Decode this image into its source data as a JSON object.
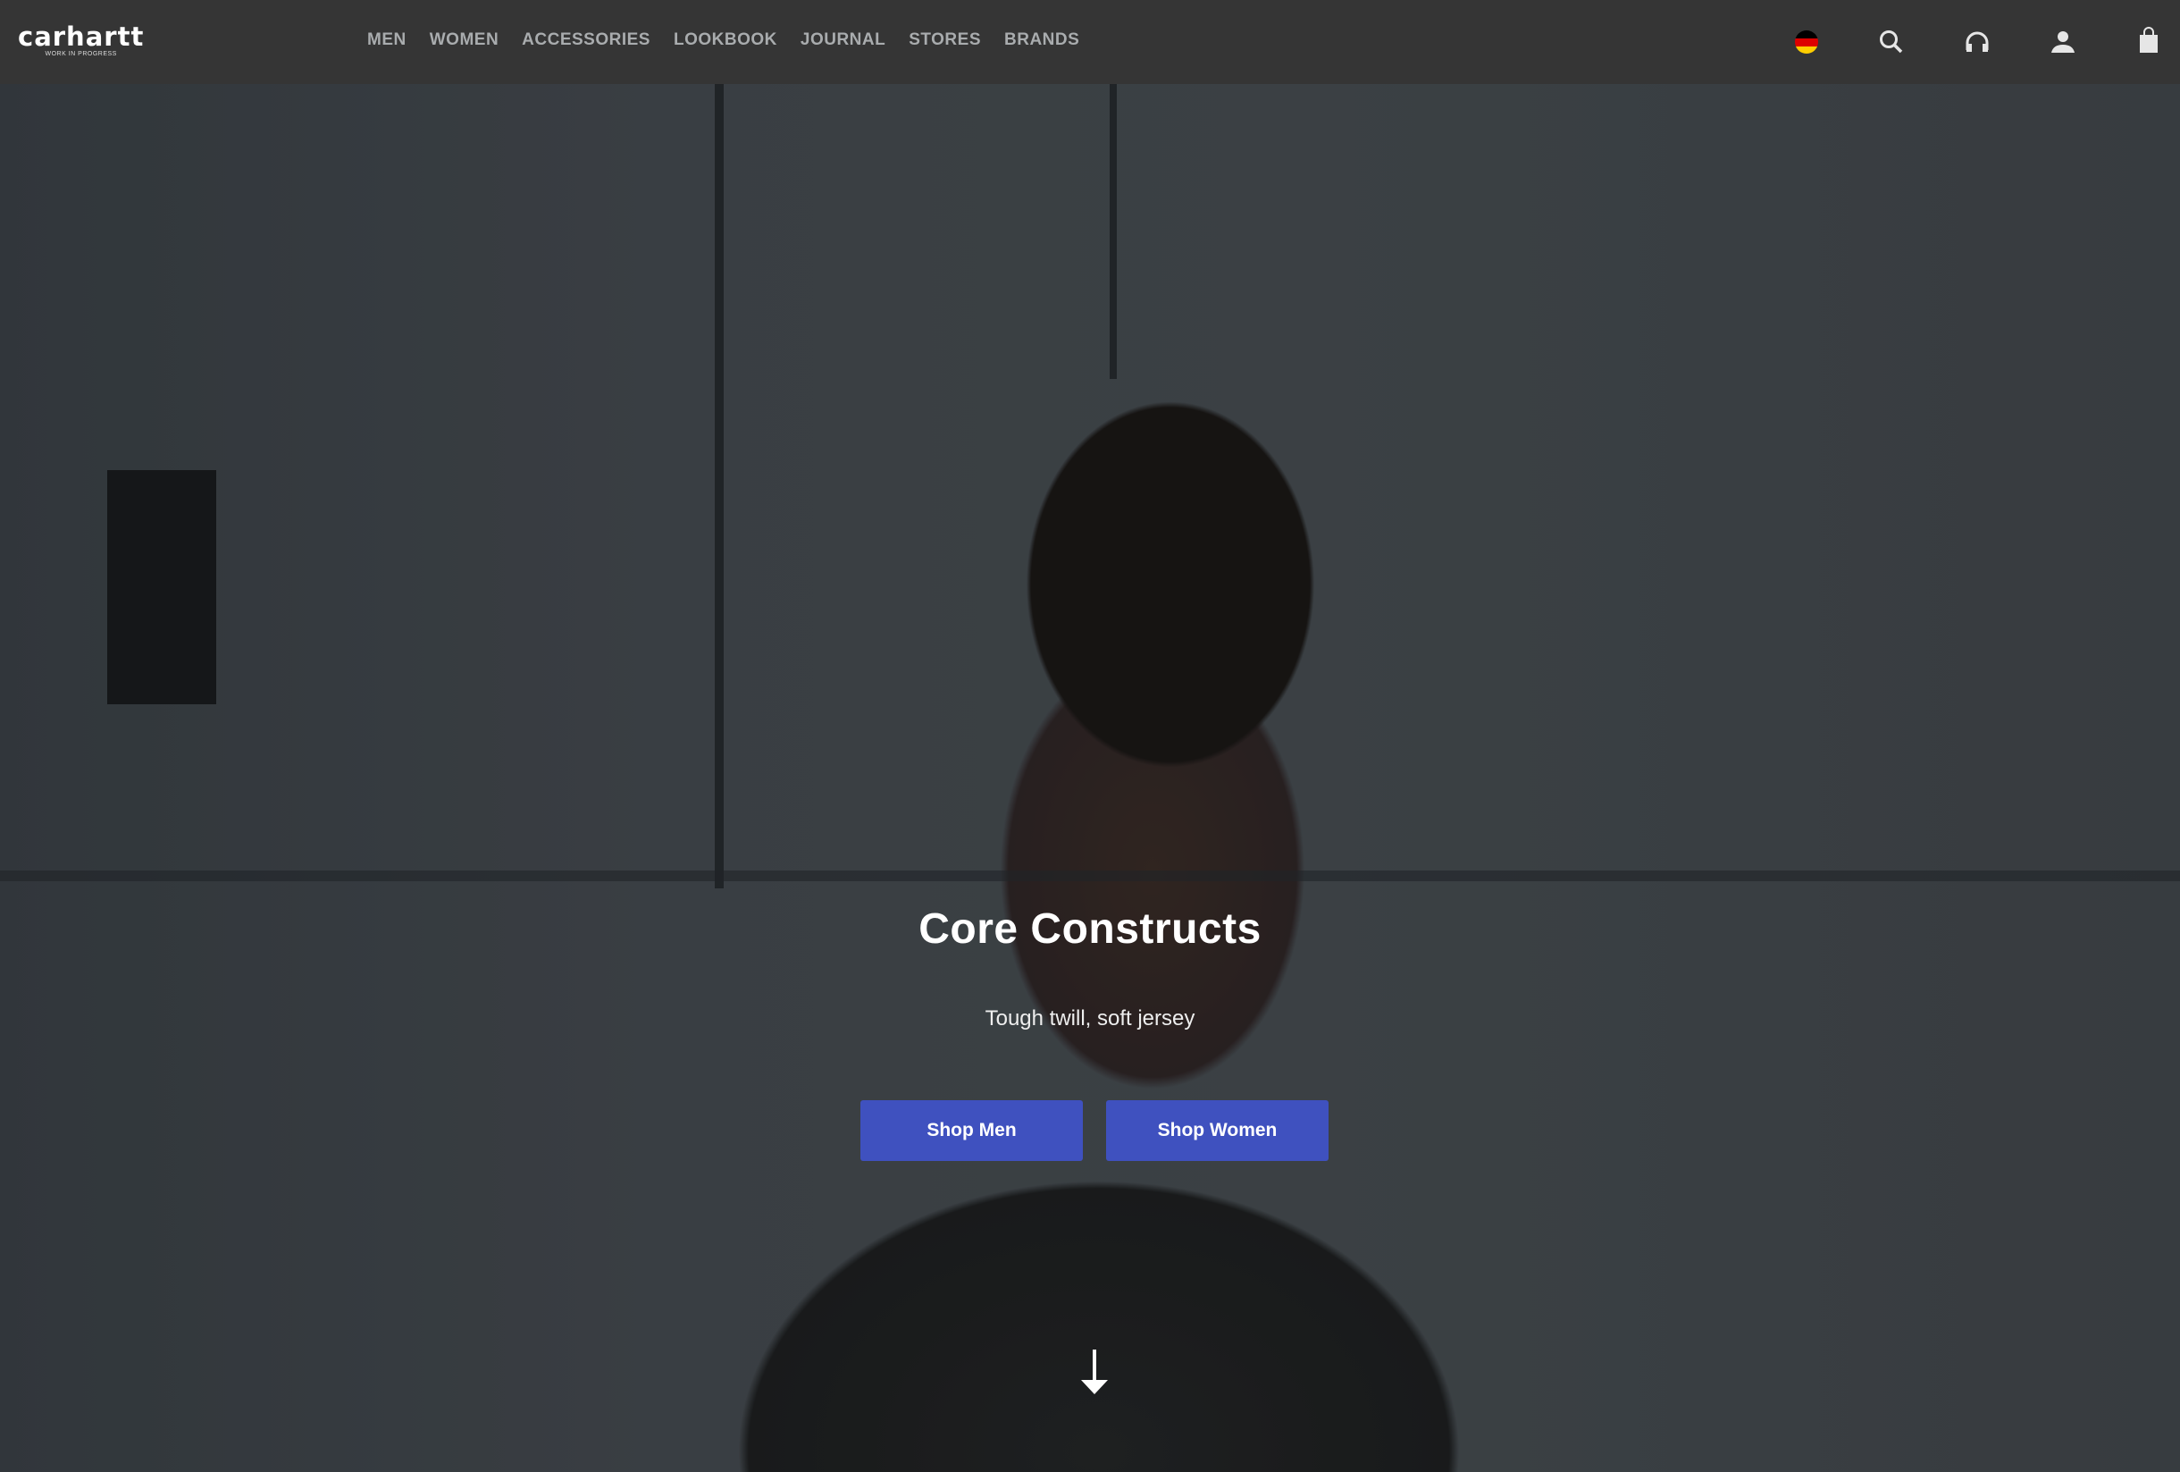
{
  "header": {
    "logo": {
      "name": "carhartt",
      "tagline": "WORK IN PROGRESS"
    },
    "nav": [
      "MEN",
      "WOMEN",
      "ACCESSORIES",
      "LOOKBOOK",
      "JOURNAL",
      "STORES",
      "BRANDS"
    ],
    "icons": [
      "germany-flag-icon",
      "search-icon",
      "headphones-icon",
      "user-icon",
      "shopping-bag-icon"
    ]
  },
  "hero": {
    "title": "Core Constructs",
    "subtitle": "Tough twill, soft jersey",
    "buttons": [
      "Shop Men",
      "Shop Women"
    ],
    "button_color": "#3f51bf",
    "scroll_icon": "arrow-down-icon"
  }
}
